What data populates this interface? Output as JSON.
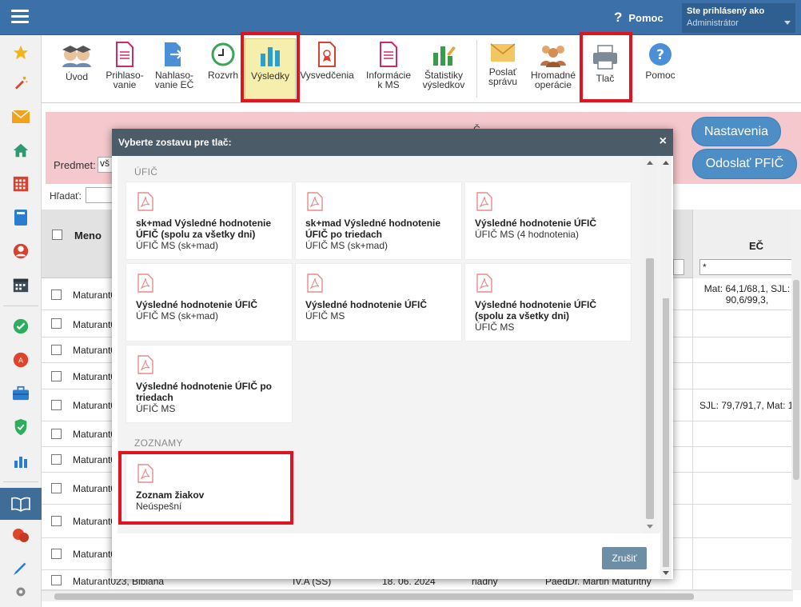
{
  "header": {
    "help_label": "Pomoc",
    "help_glyph": "?",
    "user_label": "Ste prihlásený ako",
    "user_role": "Administrátor"
  },
  "toolbar": {
    "items": [
      {
        "label": "Úvod"
      },
      {
        "label": "Prihlaso-vanie"
      },
      {
        "label": "Nahlaso-vanie EČ"
      },
      {
        "label": "Rozvrh"
      },
      {
        "label": "Výsledky"
      },
      {
        "label": "Vysvedčenia"
      },
      {
        "label": "Informácie k MS"
      },
      {
        "label": "Štatistiky výsledkov"
      },
      {
        "label": "Poslať správu"
      },
      {
        "label": "Hromadné operácie"
      },
      {
        "label": "Tlač"
      },
      {
        "label": "Pomoc"
      }
    ]
  },
  "page": {
    "pink_line": "Č",
    "predmet_label": "Predmet:",
    "predmet_value": "vš",
    "btn_nastavenia": "Nastavenia",
    "btn_odoslat": "Odoslať PFIČ",
    "hladat_label": "Hľadať:",
    "grid": {
      "col_meno": "Meno",
      "col_ec": "EČ",
      "ec_filter": "*",
      "rows": [
        {
          "name": "Maturant0",
          "ec": "Mat: 64,1/68,1, SJL: 90,6/99,3,"
        },
        {
          "name": "Maturant0",
          "ec": ""
        },
        {
          "name": "Maturant0",
          "ec": ""
        },
        {
          "name": "Maturant0",
          "ec": ""
        },
        {
          "name": "Maturant0",
          "ec": "SJL: 79,7/91,7, Mat: 1"
        },
        {
          "name": "Maturant0",
          "ec": ""
        },
        {
          "name": "Maturant0",
          "ec": ""
        },
        {
          "name": "Maturant0",
          "ec": ""
        },
        {
          "name": "Maturant0",
          "ec": ""
        },
        {
          "name": "Maturant0",
          "ec": ""
        }
      ],
      "last_row": {
        "name": "Maturant023, Bibiana",
        "class": "IV.A (SS)",
        "date": "18. 06. 2024",
        "type": "riadny",
        "teacher": "PaedDr. Martin Maturitný"
      }
    }
  },
  "modal": {
    "title": "Vyberte zostavu pre tlač:",
    "close": "×",
    "sections": [
      {
        "label": "ÚFIČ",
        "cards": [
          {
            "title": "sk+mad Výsledné hodnotenie ÚFIČ (spolu za všetky dni)",
            "subtitle": "ÚFIČ MS (sk+mad)"
          },
          {
            "title": "sk+mad Výsledné hodnotenie ÚFIČ po triedach",
            "subtitle": "ÚFIČ MS (sk+mad)"
          },
          {
            "title": "Výsledné hodnotenie ÚFIČ",
            "subtitle": "ÚFIČ MS (4 hodnotenia)"
          },
          {
            "title": "Výsledné hodnotenie ÚFIČ",
            "subtitle": "ÚFIČ MS (sk+mad)"
          },
          {
            "title": "Výsledné hodnotenie ÚFIČ",
            "subtitle": "ÚFIČ MS"
          },
          {
            "title": "Výsledné hodnotenie ÚFIČ (spolu za všetky dni)",
            "subtitle": "ÚFIČ MS"
          },
          {
            "title": "Výsledné hodnotenie ÚFIČ po triedach",
            "subtitle": "ÚFIČ MS"
          }
        ]
      },
      {
        "label": "ZOZNAMY",
        "cards": [
          {
            "title": "Zoznam žiakov",
            "subtitle": "Neúspešní"
          }
        ]
      }
    ],
    "cancel": "Zrušiť"
  },
  "colors": {
    "header_blue": "#3b71a8",
    "modal_header": "#4b5c68",
    "highlight_red": "#e0141e",
    "selected_tab_bg": "#f6eeac",
    "pink_band": "#f4c8cc",
    "pdf_icon": "#e98a8a"
  }
}
